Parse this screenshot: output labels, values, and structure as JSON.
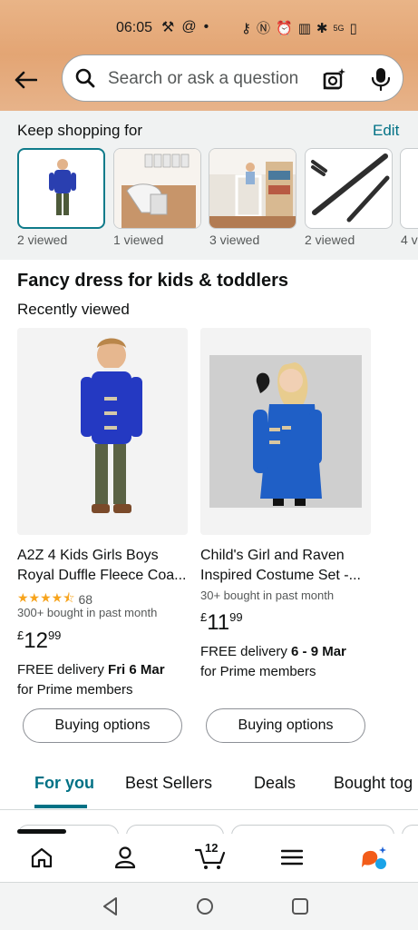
{
  "status_bar": {
    "time": "06:05",
    "network_label": "5G"
  },
  "search": {
    "placeholder": "Search or ask a question"
  },
  "keep_shopping": {
    "title": "Keep shopping for",
    "edit_label": "Edit",
    "items": [
      {
        "caption": "2 viewed"
      },
      {
        "caption": "1 viewed"
      },
      {
        "caption": "3 viewed"
      },
      {
        "caption": "2 viewed"
      },
      {
        "caption": "4 v"
      }
    ]
  },
  "section": {
    "title": "Fancy dress for kids & toddlers",
    "subtitle": "Recently viewed"
  },
  "products": [
    {
      "title_line1": "A2Z 4 Kids Girls Boys",
      "title_line2": "Royal Duffle Fleece Coa...",
      "rating_count": "68",
      "rating": 4.5,
      "bought": "300+ bought in past month",
      "price_currency": "£",
      "price_whole": "12",
      "price_fraction": "99",
      "delivery_prefix": "FREE delivery ",
      "delivery_date": "Fri 6 Mar",
      "delivery_suffix": "for Prime members",
      "button": "Buying options"
    },
    {
      "title_line1": "Child's Girl and Raven",
      "title_line2": "Inspired Costume Set -...",
      "bought": "30+ bought in past month",
      "price_currency": "£",
      "price_whole": "11",
      "price_fraction": "99",
      "delivery_prefix": "FREE delivery ",
      "delivery_date": "6 - 9 Mar",
      "delivery_suffix": "for Prime members",
      "button": "Buying options"
    }
  ],
  "tabs": [
    {
      "label": "For you",
      "active": true
    },
    {
      "label": "Best Sellers"
    },
    {
      "label": "Deals"
    },
    {
      "label": "Bought tog"
    }
  ],
  "bottom_nav": {
    "cart_count": "12",
    "icons": [
      "home-icon",
      "account-icon",
      "cart-icon",
      "menu-icon",
      "rufus-icon"
    ]
  },
  "colors": {
    "accent": "#007185",
    "header": "#e3a574",
    "stars": "#f7a41d"
  }
}
